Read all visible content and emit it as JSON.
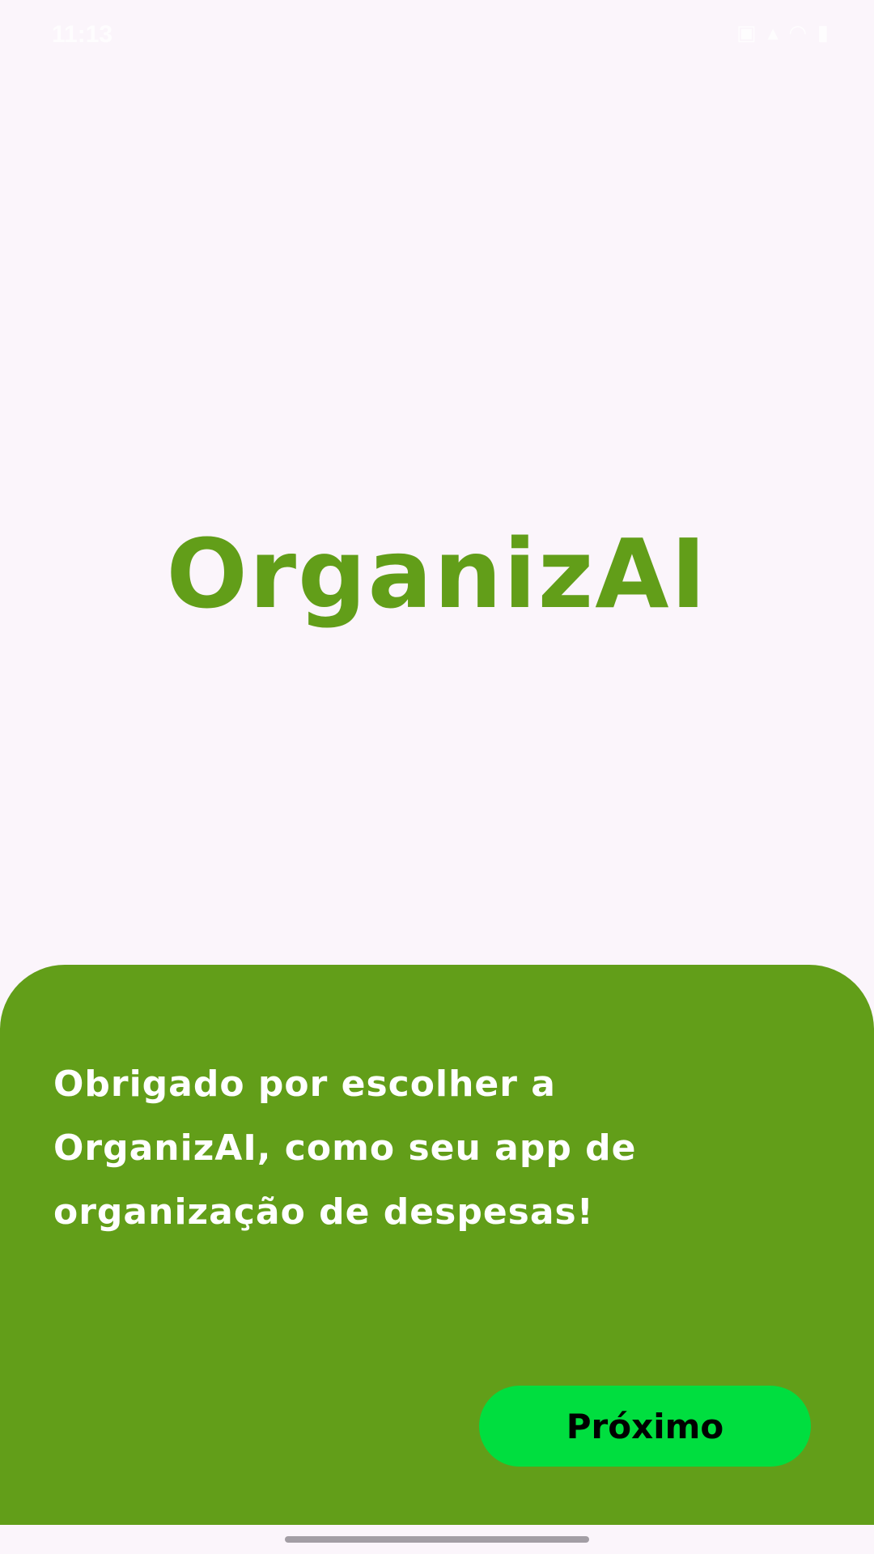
{
  "status_bar": {
    "time": "11:13",
    "icons": [
      "sim-icon",
      "signal-icon",
      "wifi-icon",
      "battery-icon"
    ]
  },
  "splash": {
    "app_name": "OrganizAI"
  },
  "bottom_panel": {
    "message": "Obrigado por escolher a OrganizAI, como seu app de organização de despesas!",
    "next_label": "Próximo"
  },
  "colors": {
    "background": "#fbf5fb",
    "brand_green": "#629e19",
    "button_green": "#00de3f",
    "home_indicator": "#a39ea5"
  }
}
